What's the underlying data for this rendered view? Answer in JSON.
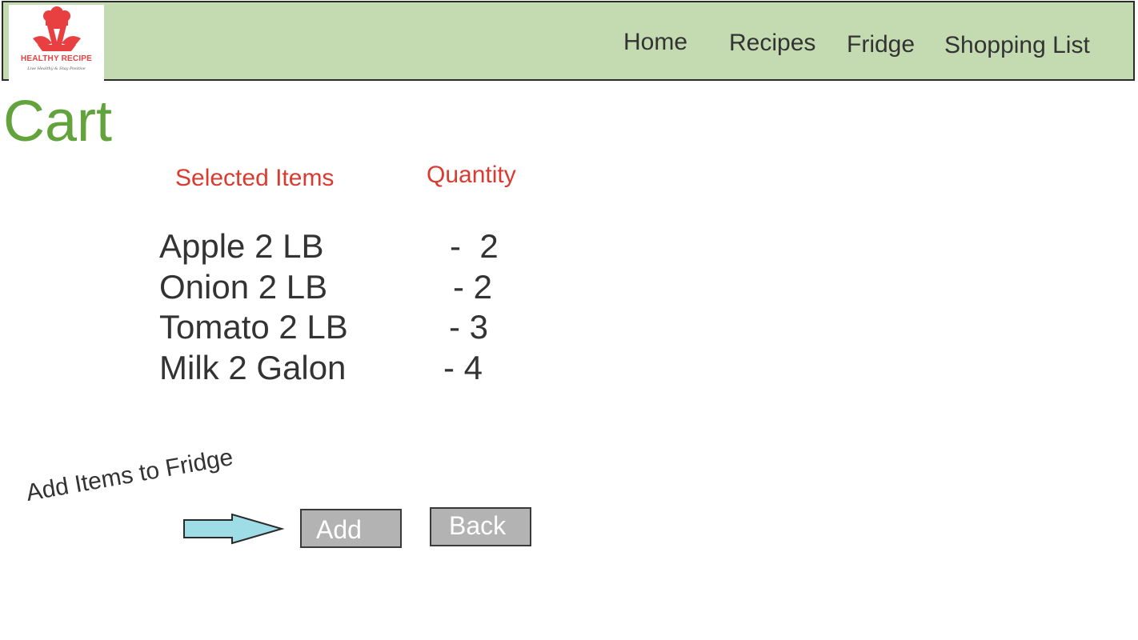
{
  "header": {
    "logo": {
      "title": "HEALTHY RECIPE",
      "tagline": "Live Healthy & Stay Positive",
      "icon": "chef-hat-icon"
    },
    "nav": [
      {
        "label": "Home"
      },
      {
        "label": "Recipes"
      },
      {
        "label": "Fridge"
      },
      {
        "label": "Shopping List"
      }
    ],
    "background_color": "#c4dbb1"
  },
  "main": {
    "title": "Cart",
    "title_color": "#62a33b",
    "columns": {
      "items_header": "Selected Items",
      "quantity_header": "Quantity",
      "header_color": "#d93b30"
    },
    "items": [
      {
        "name": "Apple 2 LB",
        "quantity": "-  2"
      },
      {
        "name": "Onion 2 LB",
        "quantity": "- 2"
      },
      {
        "name": "Tomato 2 LB",
        "quantity": "- 3"
      },
      {
        "name": "Milk 2 Galon",
        "quantity": "- 4"
      }
    ],
    "annotation": "Add Items to Fridge",
    "arrow_icon": "right-arrow-icon",
    "arrow_color": "#9edde6",
    "buttons": {
      "add": "Add",
      "back": "Back"
    }
  }
}
